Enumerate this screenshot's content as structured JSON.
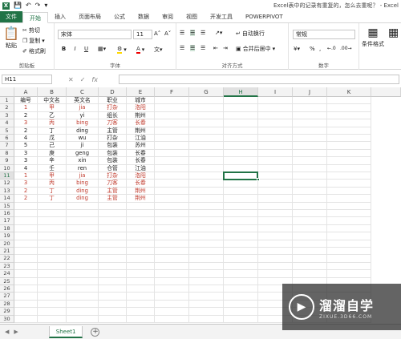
{
  "window": {
    "title": "Excel表中的记录有重复的，怎么去重呢？ - Excel"
  },
  "ribbon_tabs": [
    "文件",
    "开始",
    "插入",
    "页面布局",
    "公式",
    "数据",
    "审阅",
    "视图",
    "开发工具",
    "POWERPIVOT"
  ],
  "clipboard": {
    "paste": "粘贴",
    "cut": "剪切",
    "copy": "复制",
    "format_painter": "格式刷",
    "group": "剪贴板"
  },
  "font": {
    "name": "宋体",
    "size": "11",
    "bold": "B",
    "italic": "I",
    "underline": "U",
    "group": "字体"
  },
  "alignment": {
    "wrap": "自动换行",
    "merge": "合并后居中",
    "group": "对齐方式"
  },
  "number": {
    "format": "常规",
    "percent": "%",
    "group": "数字"
  },
  "styles": {
    "conditional": "条件格式",
    "table_format": "套用\n表格格式"
  },
  "formula_bar": {
    "name_box": "H11",
    "fx": "fx"
  },
  "columns": [
    "A",
    "B",
    "C",
    "D",
    "E",
    "F",
    "G",
    "H",
    "I",
    "J",
    "K"
  ],
  "selected_column": "H",
  "selected_row": 11,
  "header_row": [
    "编号",
    "中文名",
    "英文名",
    "职业",
    "城市"
  ],
  "rows": [
    {
      "n": "1",
      "cn": "甲",
      "en": "jia",
      "job": "打杂",
      "city": "洛阳",
      "red": true
    },
    {
      "n": "2",
      "cn": "乙",
      "en": "yi",
      "job": "组长",
      "city": "荆州",
      "red": false
    },
    {
      "n": "3",
      "cn": "丙",
      "en": "bing",
      "job": "刀客",
      "city": "长春",
      "red": true
    },
    {
      "n": "2",
      "cn": "丁",
      "en": "ding",
      "job": "主管",
      "city": "荆州",
      "red": false
    },
    {
      "n": "4",
      "cn": "戊",
      "en": "wu",
      "job": "打杂",
      "city": "江油",
      "red": false
    },
    {
      "n": "5",
      "cn": "己",
      "en": "ji",
      "job": "包装",
      "city": "苏州",
      "red": false
    },
    {
      "n": "3",
      "cn": "庚",
      "en": "geng",
      "job": "包装",
      "city": "长春",
      "red": false
    },
    {
      "n": "3",
      "cn": "辛",
      "en": "xin",
      "job": "包装",
      "city": "长春",
      "red": false
    },
    {
      "n": "4",
      "cn": "壬",
      "en": "ren",
      "job": "仓管",
      "city": "江油",
      "red": false
    },
    {
      "n": "1",
      "cn": "甲",
      "en": "jia",
      "job": "打杂",
      "city": "洛阳",
      "red": true
    },
    {
      "n": "3",
      "cn": "丙",
      "en": "bing",
      "job": "刀客",
      "city": "长春",
      "red": true
    },
    {
      "n": "2",
      "cn": "丁",
      "en": "ding",
      "job": "主管",
      "city": "荆州",
      "red": true
    },
    {
      "n": "2",
      "cn": "丁",
      "en": "ding",
      "job": "主管",
      "city": "荆州",
      "red": true
    }
  ],
  "row_numbers": [
    "1",
    "2",
    "3",
    "4",
    "5",
    "6",
    "7",
    "8",
    "9",
    "10",
    "11",
    "12",
    "13",
    "14",
    "15",
    "16",
    "17",
    "18",
    "19",
    "20",
    "21",
    "22",
    "23",
    "24",
    "25",
    "26",
    "27",
    "28",
    "29",
    "30"
  ],
  "sheet": {
    "name": "Sheet1",
    "add": "+"
  },
  "colors": {
    "accent": "#217346",
    "dup_red": "#c0392b"
  },
  "watermark": {
    "title": "溜溜自学",
    "sub": "ZIXUE.3D66.COM"
  }
}
